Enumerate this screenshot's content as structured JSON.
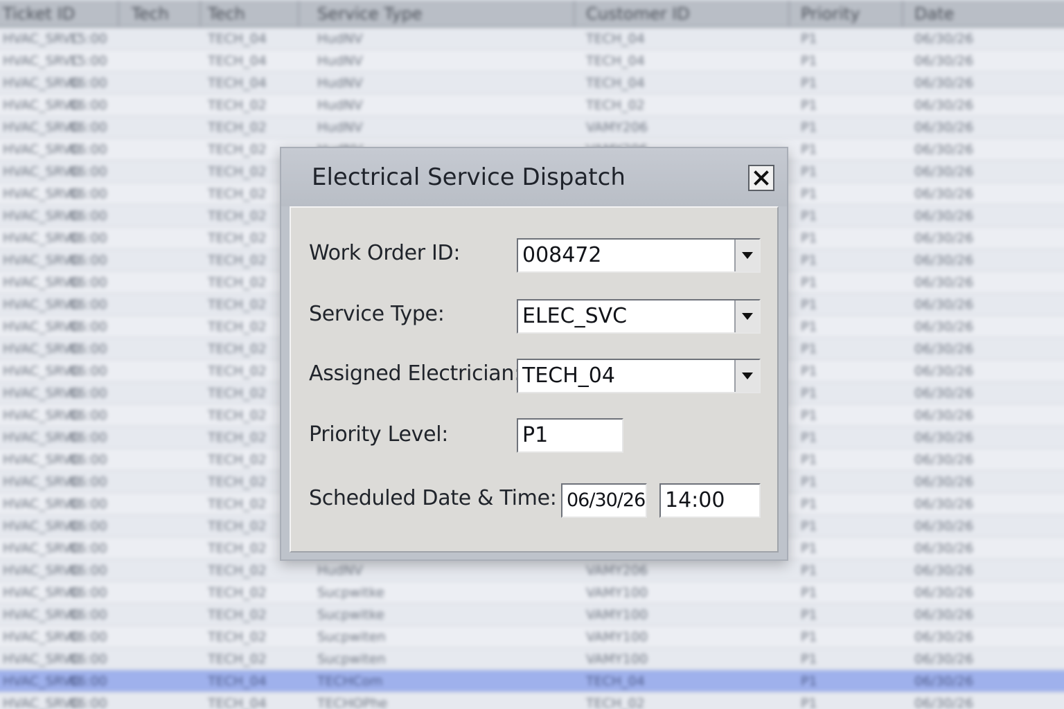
{
  "background_table": {
    "headers": [
      "Ticket ID",
      "Tech",
      "Tech",
      "Service Type",
      "Customer ID",
      "Priority",
      "Date"
    ],
    "rows": [
      [
        "HVAC_SRVC",
        "15:00",
        "TECH_04",
        "HudNV",
        "TECH_04",
        "P1",
        "06/30/26"
      ],
      [
        "HVAC_SRVC",
        "15:00",
        "TECH_04",
        "HudNV",
        "TECH_04",
        "P1",
        "06/30/26"
      ],
      [
        "HVAC_SRVC",
        "06:00",
        "TECH_04",
        "HudNV",
        "TECH_04",
        "P1",
        "06/30/26"
      ],
      [
        "HVAC_SRVC",
        "06:00",
        "TECH_02",
        "HudNV",
        "TECH_02",
        "P1",
        "06/30/26"
      ],
      [
        "HVAC_SRVC",
        "06:00",
        "TECH_02",
        "HudNV",
        "VAMY206",
        "P1",
        "06/30/26"
      ],
      [
        "HVAC_SRVC",
        "06:00",
        "TECH_02",
        "HudNV",
        "VAMY206",
        "P1",
        "06/30/26"
      ],
      [
        "HVAC_SRVC",
        "06:00",
        "TECH_02",
        "HudNV",
        "VAMY206",
        "P1",
        "06/30/26"
      ],
      [
        "HVAC_SRVC",
        "06:00",
        "TECH_02",
        "HudNV",
        "VAMY206",
        "P1",
        "06/30/26"
      ],
      [
        "HVAC_SRVC",
        "06:00",
        "TECH_02",
        "HudNV",
        "VAMY206",
        "P1",
        "06/30/26"
      ],
      [
        "HVAC_SRVC",
        "06:00",
        "TECH_02",
        "HudNV",
        "VAMY206",
        "P1",
        "06/30/26"
      ],
      [
        "HVAC_SRVC",
        "06:00",
        "TECH_02",
        "HudNV",
        "VAMY206",
        "P1",
        "06/30/26"
      ],
      [
        "HVAC_SRVC",
        "06:00",
        "TECH_02",
        "HudNV",
        "VAMY206",
        "P1",
        "06/30/26"
      ],
      [
        "HVAC_SRVC",
        "06:00",
        "TECH_02",
        "HudNV",
        "VAMY206",
        "P1",
        "06/30/26"
      ],
      [
        "HVAC_SRVC",
        "06:00",
        "TECH_02",
        "HudNV",
        "VAMY206",
        "P1",
        "06/30/26"
      ],
      [
        "HVAC_SRVC",
        "06:00",
        "TECH_02",
        "HudNV",
        "VAMY206",
        "P1",
        "06/30/26"
      ],
      [
        "HVAC_SRVC",
        "06:00",
        "TECH_02",
        "HudNV",
        "VAMY206",
        "P1",
        "06/30/26"
      ],
      [
        "HVAC_SRVC",
        "06:00",
        "TECH_02",
        "HudNV",
        "VAMY206",
        "P1",
        "06/30/26"
      ],
      [
        "HVAC_SRVC",
        "06:00",
        "TECH_02",
        "HudNV",
        "VAMY206",
        "P1",
        "06/30/26"
      ],
      [
        "HVAC_SRVC",
        "06:00",
        "TECH_02",
        "HudNV",
        "VAMY206",
        "P1",
        "06/30/26"
      ],
      [
        "HVAC_SRVC",
        "06:00",
        "TECH_02",
        "HudNV",
        "VAMY206",
        "P1",
        "06/30/26"
      ],
      [
        "HVAC_SRVC",
        "06:00",
        "TECH_02",
        "HudNV",
        "VAMY206",
        "P1",
        "06/30/26"
      ],
      [
        "HVAC_SRVC",
        "06:00",
        "TECH_02",
        "HudNV",
        "VAMY206",
        "P1",
        "06/30/26"
      ],
      [
        "HVAC_SRVC",
        "06:00",
        "TECH_02",
        "HudNV",
        "VAMY206",
        "P1",
        "06/30/26"
      ],
      [
        "HVAC_SRVC",
        "06:00",
        "TECH_02",
        "HudNV",
        "VAMY206",
        "P1",
        "06/30/26"
      ],
      [
        "HVAC_SRVC",
        "06:00",
        "TECH_02",
        "HudNV",
        "VAMY206",
        "P1",
        "06/30/26"
      ],
      [
        "HVAC_SRVC",
        "06:00",
        "TECH_02",
        "Sucpwitke",
        "VAMY100",
        "P1",
        "06/30/26"
      ],
      [
        "HVAC_SRVC",
        "06:00",
        "TECH_02",
        "Sucpwitke",
        "VAMY100",
        "P1",
        "06/30/26"
      ],
      [
        "HVAC_SRVC",
        "06:00",
        "TECH_02",
        "Sucpwiten",
        "VAMY100",
        "P1",
        "06/30/26"
      ],
      [
        "HVAC_SRVC",
        "06:00",
        "TECH_02",
        "Sucpwiten",
        "VAMY100",
        "P1",
        "06/30/26"
      ],
      [
        "HVAC_SRVC",
        "06:00",
        "TECH_04",
        "TECHCom",
        "TECH_04",
        "P1",
        "06/30/26"
      ],
      [
        "HVAC_SRVC",
        "06:00",
        "TECH_04",
        "TECHOPhe",
        "TECH_02",
        "P1",
        "06/30/26"
      ],
      [
        "HVAC_SRVC",
        "06:00",
        "TECH_04",
        "TECHOPhe",
        "TECH_02",
        "P1",
        "06/30/26"
      ]
    ],
    "selected_row": 29
  },
  "dialog": {
    "title": "Electrical Service Dispatch",
    "fields": {
      "work_order": {
        "label": "Work Order ID:",
        "value": "008472"
      },
      "service_type": {
        "label": "Service Type:",
        "value": "ELEC_SVC"
      },
      "electrician": {
        "label": "Assigned Electrician:",
        "value": "TECH_04"
      },
      "priority": {
        "label": "Priority Level:",
        "value": "P1"
      },
      "schedule": {
        "label": "Scheduled Date & Time:",
        "date": "06/30/26",
        "time": "14:00"
      }
    }
  },
  "icons": {
    "close": "close-icon",
    "dropdown": "chevron-down-icon"
  },
  "colors": {
    "selected_row": "#9fb1ec",
    "dialog_body": "#dcdbd8",
    "title_bar": "#bec3cb"
  }
}
